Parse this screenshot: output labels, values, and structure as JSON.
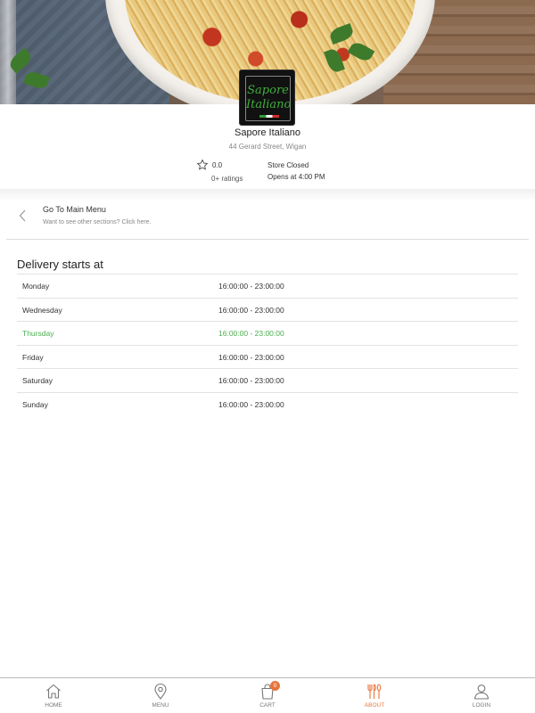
{
  "store": {
    "logo_text_top": "Sapore",
    "logo_text_bottom": "Italiano",
    "name": "Sapore Italiano",
    "address": "44 Gerard Street, Wigan",
    "rating": "0.0",
    "ratings_count": "0+ ratings",
    "status": "Store Closed",
    "opens": "Opens at 4:00 PM"
  },
  "main_menu": {
    "title": "Go To Main Menu",
    "subtitle": "Want to see other sections? Click here."
  },
  "delivery": {
    "title": "Delivery starts at",
    "rows": [
      {
        "day": "Monday",
        "time": "16:00:00 - 23:00:00"
      },
      {
        "day": "Wednesday",
        "time": "16:00:00 - 23:00:00"
      },
      {
        "day": "Thursday",
        "time": "16:00:00 - 23:00:00"
      },
      {
        "day": "Friday",
        "time": "16:00:00 - 23:00:00"
      },
      {
        "day": "Saturday",
        "time": "16:00:00 - 23:00:00"
      },
      {
        "day": "Sunday",
        "time": "16:00:00 - 23:00:00"
      }
    ],
    "highlight_color": "#4caf50"
  },
  "nav": {
    "items": [
      {
        "label": "HOME",
        "icon": "home-icon"
      },
      {
        "label": "MENU",
        "icon": "location-pin-icon"
      },
      {
        "label": "CART",
        "icon": "shopping-bag-icon",
        "badge": "0"
      },
      {
        "label": "ABOUT",
        "icon": "fork-knife-icon"
      },
      {
        "label": "LOGIN",
        "icon": "user-icon"
      }
    ],
    "active_color": "#e8743b"
  }
}
